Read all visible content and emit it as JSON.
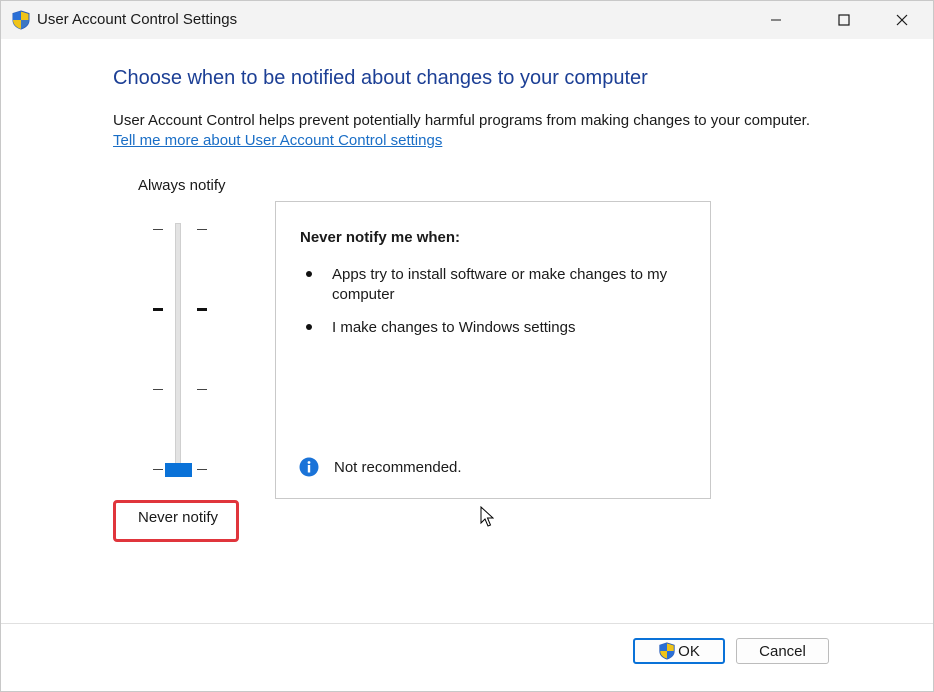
{
  "window": {
    "title": "User Account Control Settings",
    "title_icon": "uac-shield-icon"
  },
  "titlebar_controls": {
    "minimize": "minimize-icon",
    "maximize": "maximize-icon",
    "close": "close-icon"
  },
  "main": {
    "heading": "Choose when to be notified about changes to your computer",
    "description": "User Account Control helps prevent potentially harmful programs from making changes to your computer.",
    "link": "Tell me more about User Account Control settings"
  },
  "slider": {
    "top_label": "Always notify",
    "bottom_label": "Never notify",
    "levels": 4,
    "selected_level": 1,
    "accent_color": "#0a72d8",
    "highlight_color": "#e0353c"
  },
  "info_panel": {
    "title": "Never notify me when:",
    "bullets": [
      "Apps try to install software or make changes to my computer",
      "I make changes to Windows settings"
    ],
    "note_icon": "info-icon",
    "note": "Not recommended."
  },
  "buttons": {
    "ok_label": "OK",
    "cancel_label": "Cancel"
  },
  "colors": {
    "heading": "#1c3f95",
    "link": "#1a6ec6"
  }
}
